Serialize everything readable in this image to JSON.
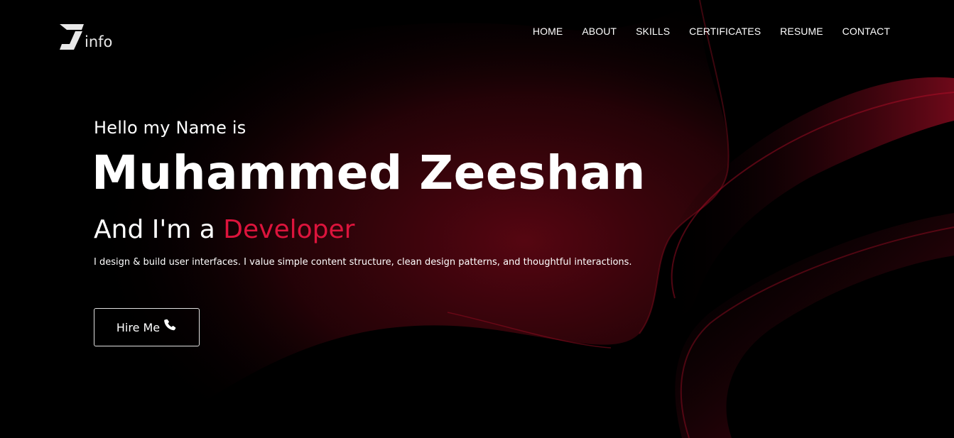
{
  "logo": {
    "text": "info",
    "icon": "z-logo-icon"
  },
  "nav": {
    "items": [
      {
        "label": "HOME"
      },
      {
        "label": "ABOUT"
      },
      {
        "label": "SKILLS"
      },
      {
        "label": "CERTIFICATES"
      },
      {
        "label": "RESUME"
      },
      {
        "label": "CONTACT"
      }
    ]
  },
  "hero": {
    "greeting": "Hello my Name is",
    "name": "Muhammed Zeeshan",
    "role_prefix": "And I'm a ",
    "role_highlight": "Developer",
    "description": "I design & build user interfaces. I value simple content structure, clean design patterns, and thoughtful interactions.",
    "hire_button_label": "Hire Me",
    "hire_button_icon": "phone-icon"
  },
  "colors": {
    "background": "#000000",
    "accent": "#dc143c",
    "wave": "#8b0a1e"
  }
}
